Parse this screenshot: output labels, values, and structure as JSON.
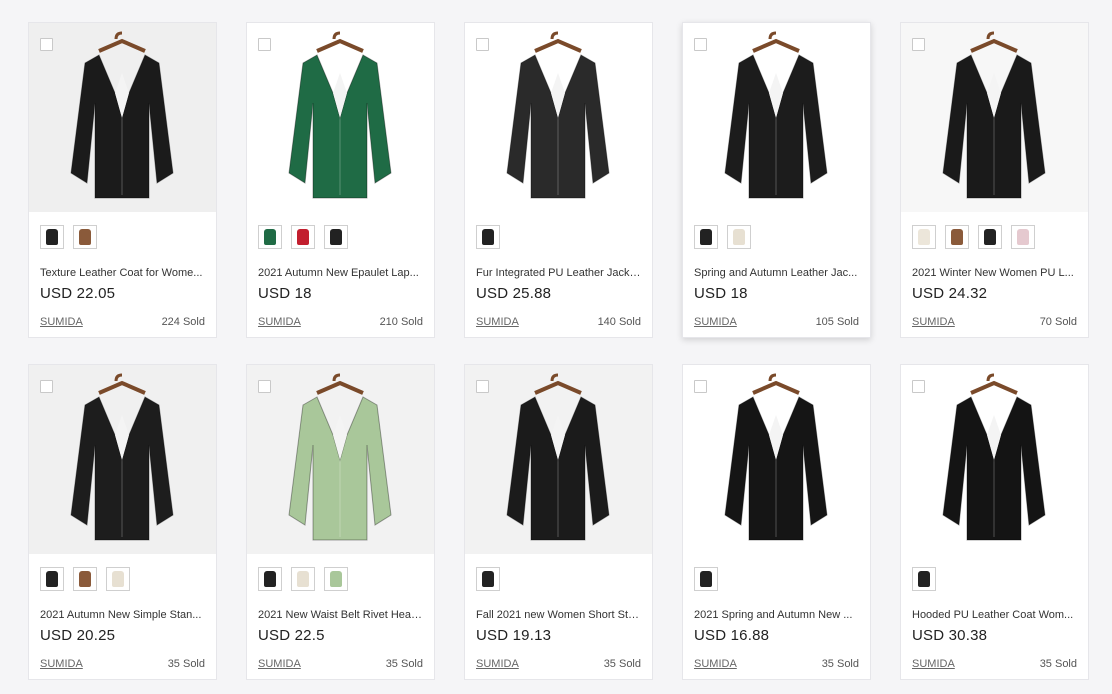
{
  "products": [
    {
      "title": "Texture Leather Coat for Wome...",
      "price": "USD 22.05",
      "store": "SUMIDA",
      "sold": "224 Sold",
      "jacket_color": "#1b1b1b",
      "bg_color": "#efefef",
      "swatches": [
        "#222222",
        "#8a5a3a"
      ]
    },
    {
      "title": "2021 Autumn New Epaulet Lap...",
      "price": "USD 18",
      "store": "SUMIDA",
      "sold": "210 Sold",
      "jacket_color": "#1f6b45",
      "bg_color": "#ffffff",
      "swatches": [
        "#1f6b45",
        "#c21e2e",
        "#222222"
      ]
    },
    {
      "title": "Fur Integrated PU Leather Jacke...",
      "price": "USD 25.88",
      "store": "SUMIDA",
      "sold": "140 Sold",
      "jacket_color": "#2a2a2a",
      "bg_color": "#ffffff",
      "swatches": [
        "#222222"
      ]
    },
    {
      "title": "Spring and Autumn Leather Jac...",
      "price": "USD 18",
      "store": "SUMIDA",
      "sold": "105 Sold",
      "jacket_color": "#1c1c1c",
      "bg_color": "#ffffff",
      "swatches": [
        "#222222",
        "#e7e0d2"
      ]
    },
    {
      "title": "2021 Winter New Women PU L...",
      "price": "USD 24.32",
      "store": "SUMIDA",
      "sold": "70 Sold",
      "jacket_color": "#1a1a1a",
      "bg_color": "#f7f7f7",
      "swatches": [
        "#ece6da",
        "#8a5a3a",
        "#222222",
        "#e5c9cf"
      ]
    },
    {
      "title": "2021 Autumn New Simple Stan...",
      "price": "USD 20.25",
      "store": "SUMIDA",
      "sold": "35 Sold",
      "jacket_color": "#1d1d1d",
      "bg_color": "#f0f0f0",
      "swatches": [
        "#222222",
        "#8a5a3a",
        "#e7e0d2"
      ]
    },
    {
      "title": "2021 New Waist Belt Rivet Heav...",
      "price": "USD 22.5",
      "store": "SUMIDA",
      "sold": "35 Sold",
      "jacket_color": "#a9c79a",
      "bg_color": "#f2f2f2",
      "swatches": [
        "#222222",
        "#e7e0d2",
        "#a9c79a"
      ]
    },
    {
      "title": "Fall 2021 new Women Short Sta...",
      "price": "USD 19.13",
      "store": "SUMIDA",
      "sold": "35 Sold",
      "jacket_color": "#1b1b1b",
      "bg_color": "#f2f2f2",
      "swatches": [
        "#222222"
      ]
    },
    {
      "title": "2021 Spring and Autumn New ...",
      "price": "USD 16.88",
      "store": "SUMIDA",
      "sold": "35 Sold",
      "jacket_color": "#151515",
      "bg_color": "#ffffff",
      "swatches": [
        "#222222"
      ]
    },
    {
      "title": "Hooded PU Leather Coat Wom...",
      "price": "USD 30.38",
      "store": "SUMIDA",
      "sold": "35 Sold",
      "jacket_color": "#141414",
      "bg_color": "#ffffff",
      "swatches": [
        "#222222"
      ]
    }
  ]
}
